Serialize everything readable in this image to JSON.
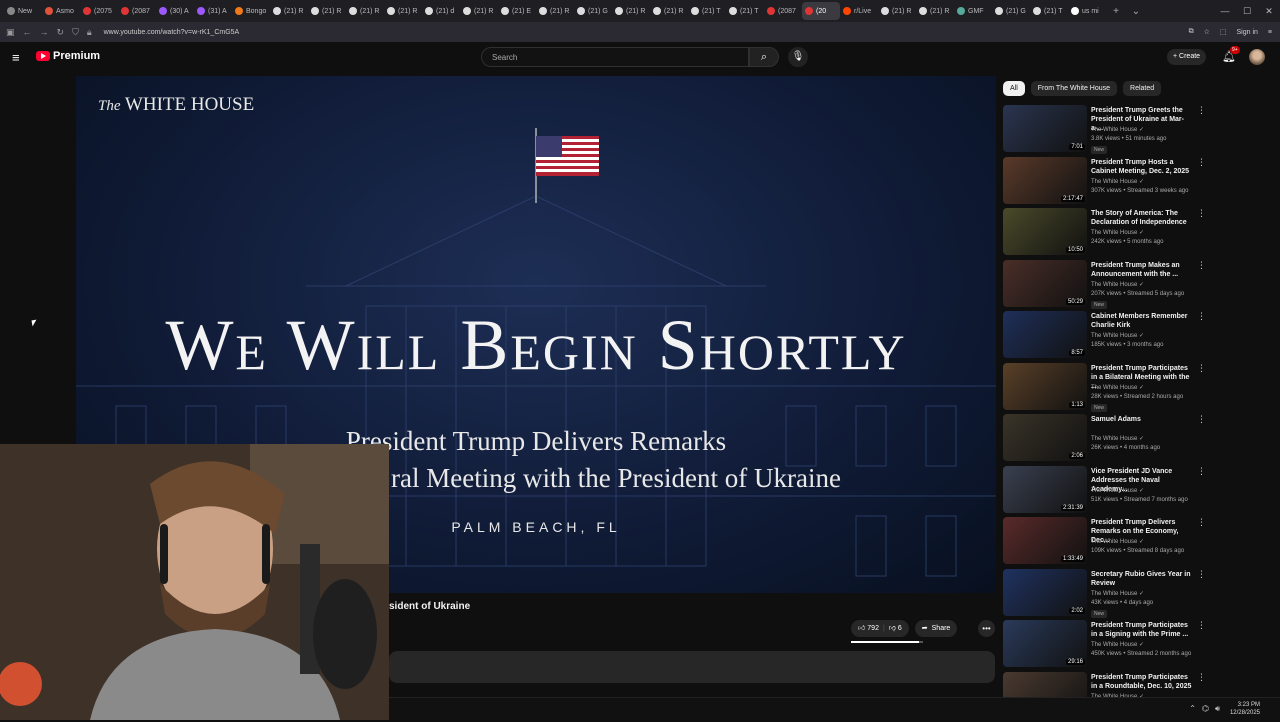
{
  "browser": {
    "tabs": [
      "New",
      "Asmo",
      "(2075",
      "(2087",
      "(30) A",
      "(31) A",
      "Bongo",
      "(21) R",
      "(21) R",
      "(21) R",
      "(21) R",
      "(21) d",
      "(21) R",
      "(21) E",
      "(21) R",
      "(21) G",
      "(21) R",
      "(21) R",
      "(21) T",
      "(21) T",
      "(2087",
      "(20",
      "r/Live",
      "(21) R",
      "(21) R",
      "GMF",
      "(21) G",
      "(21) T",
      "us mi"
    ],
    "url": "www.youtube.com/watch?v=w-rK1_CmG5A",
    "sign_in": "Sign in"
  },
  "header": {
    "logo_text": "Premium",
    "search_placeholder": "Search",
    "create_label": "Create",
    "notif_count": "9+"
  },
  "player": {
    "brand_prefix": "The",
    "brand": "WHITE HOUSE",
    "headline": "We Will Begin Shortly",
    "line1": "President Trump Delivers Remarks",
    "line2": "ral Meeting with the President of Ukraine",
    "location": "PALM BEACH, FL"
  },
  "video": {
    "title_visible": "sident of Ukraine",
    "likes": "792",
    "dislikes": "6",
    "share_label": "Share",
    "like_ratio": 0.95
  },
  "chips": [
    "All",
    "From The White House",
    "Related"
  ],
  "recommendations": [
    {
      "title": "President Trump Greets the President of Ukraine at Mar-a-...",
      "channel": "The White House",
      "meta": "3.8K views • 51 minutes ago",
      "duration": "7:01",
      "badge": "New",
      "color": "#2a3550"
    },
    {
      "title": "President Trump Hosts a Cabinet Meeting, Dec. 2, 2025",
      "channel": "The White House",
      "meta": "307K views • Streamed 3 weeks ago",
      "duration": "2:17:47",
      "badge": "",
      "color": "#5a3a2a"
    },
    {
      "title": "The Story of America: The Declaration of Independence",
      "channel": "The White House",
      "meta": "242K views • 5 months ago",
      "duration": "10:50",
      "badge": "",
      "color": "#4a4a2a"
    },
    {
      "title": "President Trump Makes an Announcement with the ...",
      "channel": "The White House",
      "meta": "207K views • Streamed 5 days ago",
      "duration": "50:29",
      "badge": "New",
      "color": "#4a2e28"
    },
    {
      "title": "Cabinet Members Remember Charlie Kirk",
      "channel": "The White House",
      "meta": "185K views • 3 months ago",
      "duration": "8:57",
      "badge": "",
      "color": "#1f2f5a"
    },
    {
      "title": "President Trump Participates in a Bilateral Meeting with the ...",
      "channel": "The White House",
      "meta": "28K views • Streamed 2 hours ago",
      "duration": "1:13",
      "badge": "New",
      "color": "#5a4028"
    },
    {
      "title": "Samuel Adams",
      "channel": "The White House",
      "meta": "26K views • 4 months ago",
      "duration": "2:06",
      "badge": "",
      "color": "#3a3428"
    },
    {
      "title": "Vice President JD Vance Addresses the Naval Academy...",
      "channel": "The White House",
      "meta": "51K views • Streamed 7 months ago",
      "duration": "2:31:39",
      "badge": "",
      "color": "#3a4050"
    },
    {
      "title": "President Trump Delivers Remarks on the Economy, Dec...",
      "channel": "The White House",
      "meta": "109K views • Streamed 8 days ago",
      "duration": "1:33:49",
      "badge": "",
      "color": "#5a2a2a"
    },
    {
      "title": "Secretary Rubio Gives Year in Review",
      "channel": "The White House",
      "meta": "43K views • 4 days ago",
      "duration": "2:02",
      "badge": "New",
      "color": "#1f3260"
    },
    {
      "title": "President Trump Participates in a Signing with the Prime ...",
      "channel": "The White House",
      "meta": "450K views • Streamed 2 months ago",
      "duration": "29:16",
      "badge": "",
      "color": "#2a3a5a"
    },
    {
      "title": "President Trump Participates in a Roundtable, Dec. 10, 2025",
      "channel": "The White House",
      "meta": "",
      "duration": "",
      "badge": "",
      "color": "#4a3a30"
    }
  ],
  "taskbar": {
    "time": "3:23 PM",
    "date": "12/28/2025"
  }
}
